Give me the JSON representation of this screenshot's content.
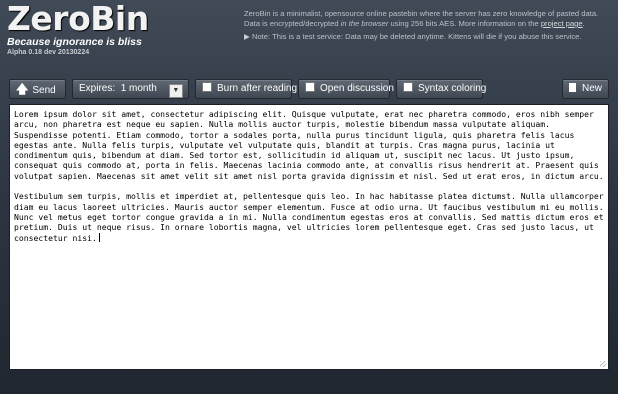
{
  "header": {
    "title": "ZeroBin",
    "tagline": "Because ignorance is bliss",
    "version": "Alpha 0.18 dev 20130224"
  },
  "about": {
    "line1": "ZeroBin is a minimalist, opensource online pastebin where the server has zero knowledge of pasted data.",
    "line2_prefix": "Data is encrypted/decrypted",
    "line2_italic": "in the browser",
    "line2_suffix": "using 256 bits AES. More information on the",
    "project_link": "project page",
    "line2_end": ".",
    "note": "Note: This is a test service: Data may be deleted anytime. Kittens will die if you abuse this service."
  },
  "toolbar": {
    "send_label": "Send",
    "expires_label": "Expires:",
    "expires_value": "1 month",
    "burn_label": "Burn after reading",
    "discussion_label": "Open discussion",
    "syntax_label": "Syntax coloring",
    "new_label": "New"
  },
  "editor": {
    "paragraph1": "Lorem ipsum dolor sit amet, consectetur adipiscing elit. Quisque vulputate, erat nec pharetra commodo, eros nibh semper arcu, non pharetra est neque eu sapien. Nulla mollis auctor turpis, molestie bibendum massa vulputate aliquam. Suspendisse potenti. Etiam commodo, tortor a sodales porta, nulla purus tincidunt ligula, quis pharetra felis lacus egestas ante. Nulla felis turpis, vulputate vel vulputate quis, blandit at turpis. Cras magna purus, lacinia ut condimentum quis, bibendum at diam. Sed tortor est, sollicitudin id aliquam ut, suscipit nec lacus. Ut justo ipsum, consequat quis commodo at, porta in felis. Maecenas lacinia commodo ante, at convallis risus hendrerit at. Praesent quis volutpat sapien. Maecenas sit amet velit sit amet nisl porta gravida dignissim et nisl. Sed ut erat eros, in dictum arcu.",
    "paragraph2": "Vestibulum sem turpis, mollis et imperdiet at, pellentesque quis leo. In hac habitasse platea dictumst. Nulla ullamcorper diam eu lacus laoreet ultricies. Mauris auctor semper elementum. Fusce at odio urna. Ut faucibus vestibulum mi eu mollis. Nunc vel metus eget tortor congue gravida a in mi. Nulla condimentum egestas eros at convallis. Sed mattis dictum eros et pretium. Duis ut neque risus. In ornare lobortis magna, vel ultricies lorem pellentesque eget. Cras sed justo lacus, ut consectetur nisi."
  }
}
